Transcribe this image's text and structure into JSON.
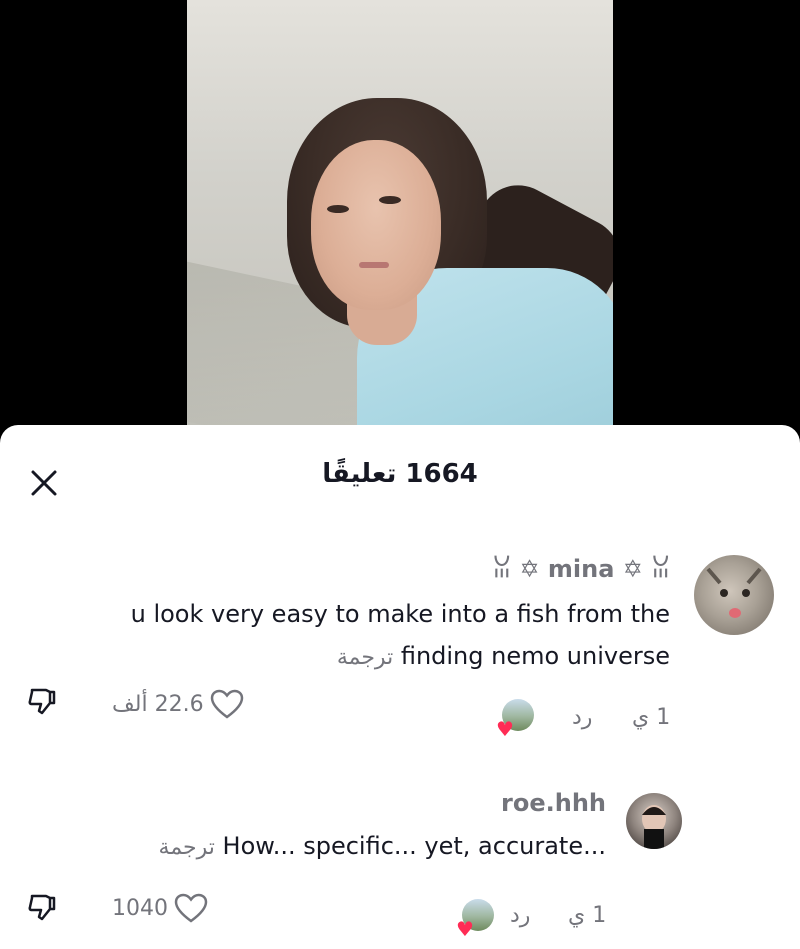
{
  "sheet": {
    "title": "1664 تعليقًا"
  },
  "comments": [
    {
      "username": "ꈍ ✡ mina ✡ ꈍ",
      "text_line1": "u look very easy to make into a fish from the",
      "text_line2": "finding nemo universe",
      "translate": "ترجمة",
      "time": "1 ي",
      "reply": "رد",
      "likes": "22.6 ألف"
    },
    {
      "username": "roe.hhh",
      "text_line1": "How... specific... yet, accurate...",
      "translate": "ترجمة",
      "time": "1 ي",
      "reply": "رد",
      "likes": "1040"
    }
  ],
  "icons": {
    "close": "close-icon",
    "like": "heart-icon",
    "dislike": "thumbs-down-icon"
  },
  "colors": {
    "heart_accent": "#ff2c55",
    "secondary_text": "#73747b"
  }
}
